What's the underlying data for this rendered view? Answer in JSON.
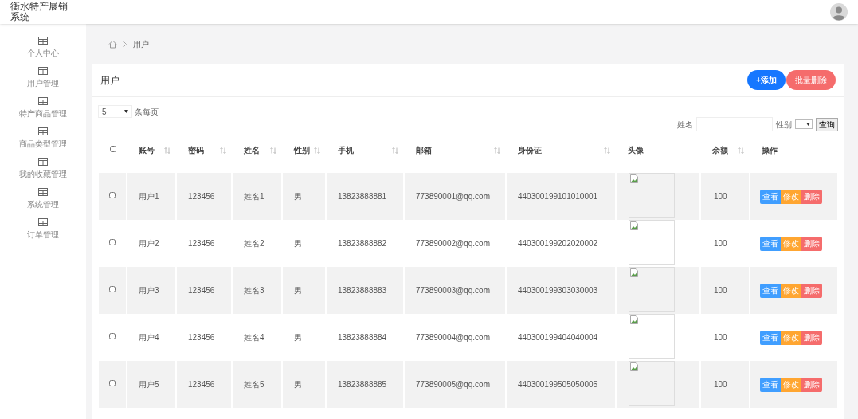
{
  "app_title": [
    "衡水特产展销",
    "系统"
  ],
  "sidebar": {
    "items": [
      {
        "label": "个人中心"
      },
      {
        "label": "用户管理"
      },
      {
        "label": "特产商品管理"
      },
      {
        "label": "商品类型管理"
      },
      {
        "label": "我的收藏管理"
      },
      {
        "label": "系统管理"
      },
      {
        "label": "订单管理"
      }
    ]
  },
  "breadcrumb": [
    "用户"
  ],
  "page_title": "用户",
  "toolbar": {
    "add": "+添加",
    "batch_delete": "批量删除"
  },
  "page_size": {
    "value": "5",
    "label": "条每页"
  },
  "filters": {
    "name_label": "姓名",
    "gender_label": "性别",
    "search": "查询"
  },
  "table": {
    "select_all_checked": false,
    "columns": [
      {
        "label": "账号",
        "sortable": true
      },
      {
        "label": "密码",
        "sortable": true
      },
      {
        "label": "姓名",
        "sortable": true
      },
      {
        "label": "性别",
        "sortable": true
      },
      {
        "label": "手机",
        "sortable": true
      },
      {
        "label": "邮箱",
        "sortable": true
      },
      {
        "label": "身份证",
        "sortable": true
      },
      {
        "label": "头像",
        "sortable": false
      },
      {
        "label": "余额",
        "sortable": true
      },
      {
        "label": "操作",
        "sortable": false
      }
    ],
    "rows": [
      {
        "cells": [
          "用户1",
          "123456",
          "姓名1",
          "男",
          "13823888881",
          "773890001@qq.com",
          "440300199101010001",
          "100"
        ],
        "checked": false,
        "actions": [
          "查看",
          "修改",
          "删除"
        ]
      },
      {
        "cells": [
          "用户2",
          "123456",
          "姓名2",
          "男",
          "13823888882",
          "773890002@qq.com",
          "440300199202020002",
          "100"
        ],
        "checked": false,
        "actions": [
          "查看",
          "修改",
          "删除"
        ]
      },
      {
        "cells": [
          "用户3",
          "123456",
          "姓名3",
          "男",
          "13823888883",
          "773890003@qq.com",
          "440300199303030003",
          "100"
        ],
        "checked": false,
        "actions": [
          "查看",
          "修改",
          "删除"
        ]
      },
      {
        "cells": [
          "用户4",
          "123456",
          "姓名4",
          "男",
          "13823888884",
          "773890004@qq.com",
          "440300199404040004",
          "100"
        ],
        "checked": false,
        "actions": [
          "查看",
          "修改",
          "删除"
        ]
      },
      {
        "cells": [
          "用户5",
          "123456",
          "姓名5",
          "男",
          "13823888885",
          "773890005@qq.com",
          "440300199505050005",
          "100"
        ],
        "checked": false,
        "actions": [
          "查看",
          "修改",
          "删除"
        ]
      }
    ]
  }
}
